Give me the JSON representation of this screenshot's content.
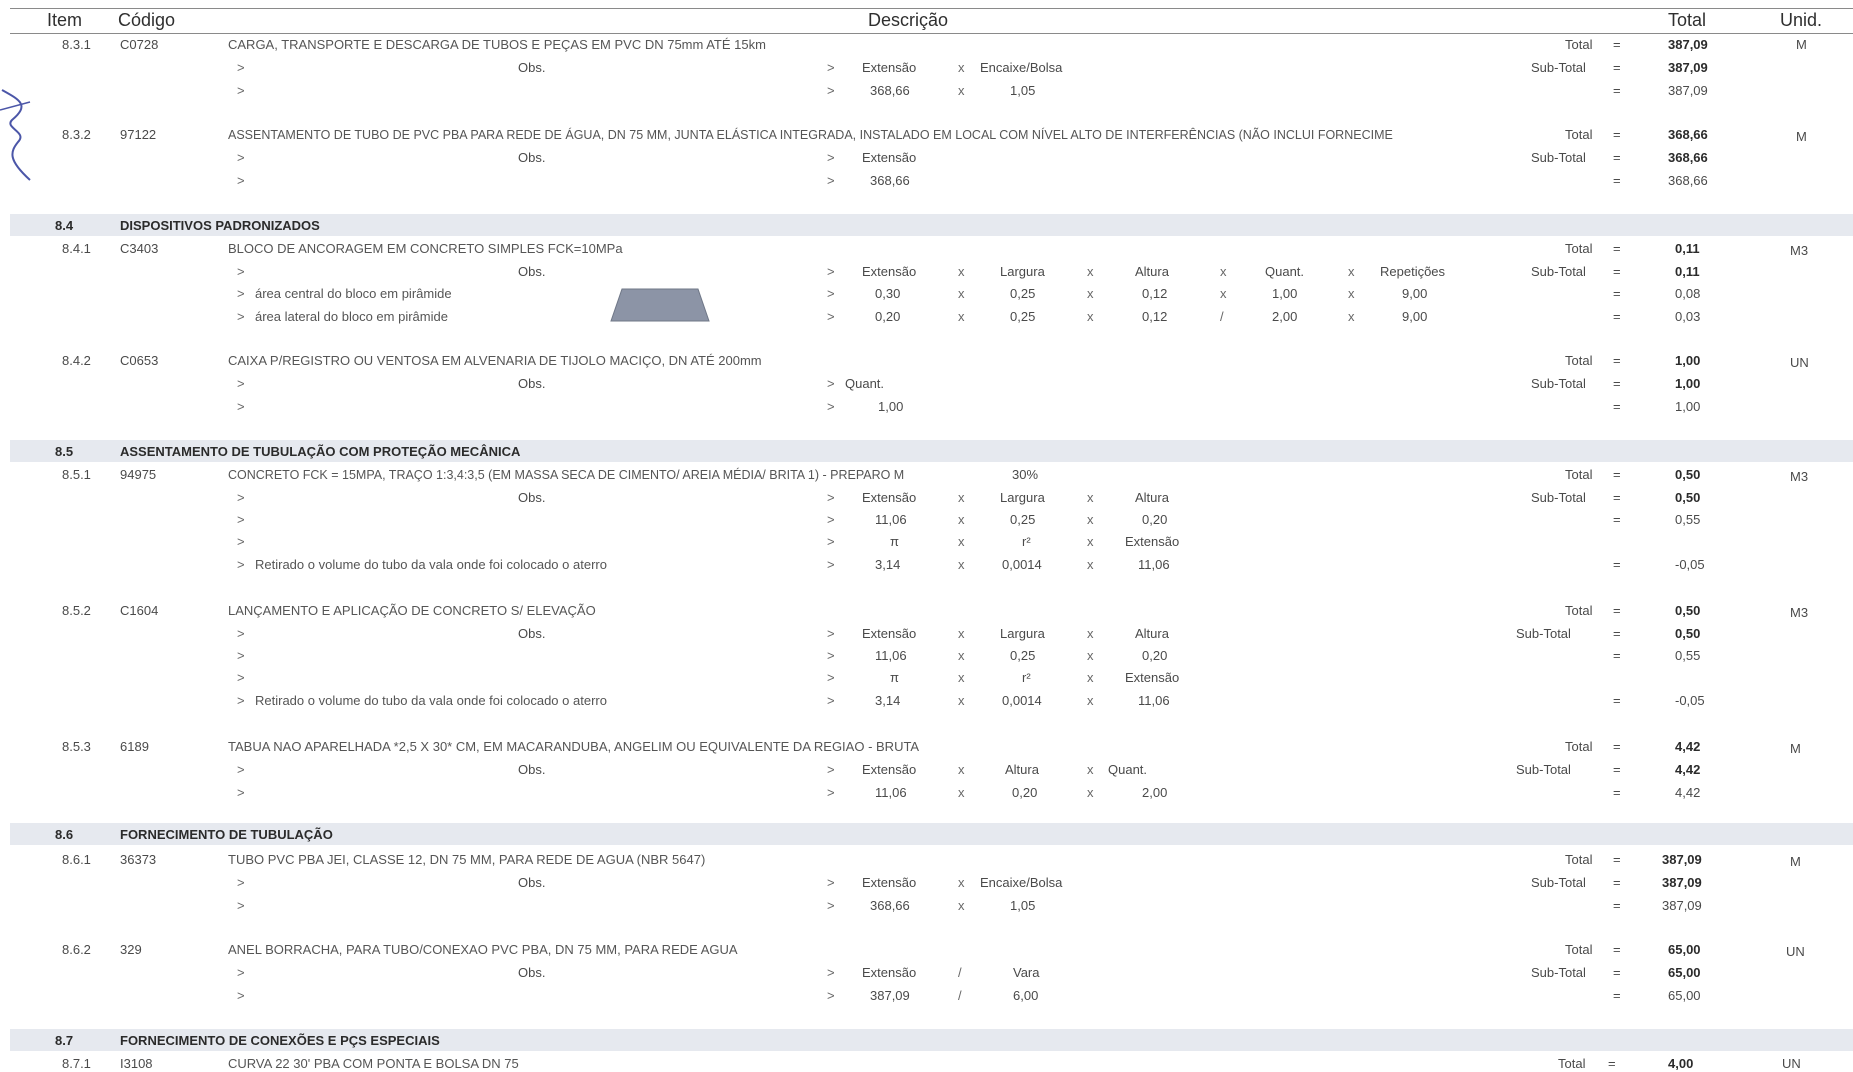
{
  "header": {
    "item": "Item",
    "codigo": "Código",
    "descricao": "Descrição",
    "total": "Total",
    "unid": "Unid."
  },
  "sections": [
    {
      "code": "8.4",
      "title": "DISPOSITIVOS PADRONIZADOS"
    },
    {
      "code": "8.5",
      "title": "ASSENTAMENTO DE TUBULAÇÃO COM PROTEÇÃO MECÂNICA"
    },
    {
      "code": "8.6",
      "title": "FORNECIMENTO DE TUBULAÇÃO"
    },
    {
      "code": "8.7",
      "title": "FORNECIMENTO DE CONEXÕES E PÇS ESPECIAIS"
    }
  ],
  "labels": {
    "total": "Total",
    "subtotal": "Sub-Total",
    "eq": "=",
    "gt": ">",
    "obs": "Obs.",
    "x": "x",
    "slash": "/",
    "extensao": "Extensão",
    "encaixe": "Encaixe/Bolsa",
    "largura": "Largura",
    "altura": "Altura",
    "quant": "Quant.",
    "repeticoes": "Repetições",
    "pi": "π",
    "r2": "r²",
    "vara": "Vara",
    "retirado": "Retirado o volume do tubo da vala onde foi colocado o aterro",
    "area_central": "área central do bloco em pirâmide",
    "area_lateral": "área lateral do bloco em pirâmide",
    "pct": "30%"
  },
  "items": [
    {
      "item": "8.3.1",
      "code": "C0728",
      "desc": "CARGA, TRANSPORTE E DESCARGA DE TUBOS E PEÇAS EM PVC DN 75mm ATÉ 15km",
      "total": "387,09",
      "subtotal": "387,09",
      "unit": "M",
      "vals": [
        "368,66",
        "1,05"
      ],
      "result": "387,09"
    },
    {
      "item": "8.3.2",
      "code": "97122",
      "desc": "ASSENTAMENTO DE TUBO DE PVC PBA PARA REDE DE ÁGUA, DN 75 MM, JUNTA ELÁSTICA INTEGRADA, INSTALADO EM LOCAL COM NÍVEL ALTO DE INTERFERÊNCIAS (NÃO INCLUI FORNECIME",
      "total": "368,66",
      "subtotal": "368,66",
      "unit": "M",
      "vals": [
        "368,66"
      ],
      "result": "368,66"
    },
    {
      "item": "8.4.1",
      "code": "C3403",
      "desc": "BLOCO DE ANCORAGEM EM CONCRETO SIMPLES FCK=10MPa",
      "total": "0,11",
      "subtotal": "0,11",
      "unit": "M3",
      "row1": [
        "0,30",
        "0,25",
        "0,12",
        "1,00",
        "9,00"
      ],
      "r1": "0,08",
      "row2": [
        "0,20",
        "0,25",
        "0,12",
        "2,00",
        "9,00"
      ],
      "r2": "0,03"
    },
    {
      "item": "8.4.2",
      "code": "C0653",
      "desc": "CAIXA P/REGISTRO OU VENTOSA EM ALVENARIA DE TIJOLO MACIÇO, DN ATÉ 200mm",
      "total": "1,00",
      "subtotal": "1,00",
      "unit": "UN",
      "vals": [
        "1,00"
      ],
      "result": "1,00"
    },
    {
      "item": "8.5.1",
      "code": "94975",
      "desc": "CONCRETO FCK = 15MPA, TRAÇO 1:3,4:3,5 (EM MASSA SECA DE CIMENTO/ AREIA MÉDIA/ BRITA 1) - PREPARO M",
      "total": "0,50",
      "subtotal": "0,50",
      "unit": "M3",
      "row1": [
        "11,06",
        "0,25",
        "0,20"
      ],
      "r1": "0,55",
      "row2": [
        "3,14",
        "0,0014",
        "11,06"
      ],
      "r2": "-0,05"
    },
    {
      "item": "8.5.2",
      "code": "C1604",
      "desc": "LANÇAMENTO E APLICAÇÃO DE CONCRETO S/ ELEVAÇÃO",
      "total": "0,50",
      "subtotal": "0,50",
      "unit": "M3",
      "row1": [
        "11,06",
        "0,25",
        "0,20"
      ],
      "r1": "0,55",
      "row2": [
        "3,14",
        "0,0014",
        "11,06"
      ],
      "r2": "-0,05"
    },
    {
      "item": "8.5.3",
      "code": "6189",
      "desc": "TABUA NAO APARELHADA *2,5 X 30* CM, EM MACARANDUBA, ANGELIM OU EQUIVALENTE DA REGIAO - BRUTA",
      "total": "4,42",
      "subtotal": "4,42",
      "unit": "M",
      "vals": [
        "11,06",
        "0,20",
        "2,00"
      ],
      "result": "4,42"
    },
    {
      "item": "8.6.1",
      "code": "36373",
      "desc": "TUBO PVC PBA JEI, CLASSE 12, DN 75 MM, PARA REDE DE AGUA (NBR 5647)",
      "total": "387,09",
      "subtotal": "387,09",
      "unit": "M",
      "vals": [
        "368,66",
        "1,05"
      ],
      "result": "387,09"
    },
    {
      "item": "8.6.2",
      "code": "329",
      "desc": "ANEL BORRACHA, PARA TUBO/CONEXAO PVC PBA, DN 75 MM, PARA REDE AGUA",
      "total": "65,00",
      "subtotal": "65,00",
      "unit": "UN",
      "vals": [
        "387,09",
        "6,00"
      ],
      "result": "65,00"
    },
    {
      "item": "8.7.1",
      "code": "I3108",
      "desc": "CURVA 22 30' PBA COM PONTA E BOLSA DN  75",
      "total": "4,00",
      "unit": "UN"
    }
  ],
  "colors": {
    "band": "#e6e9ef",
    "sig": "#4b56a8"
  }
}
